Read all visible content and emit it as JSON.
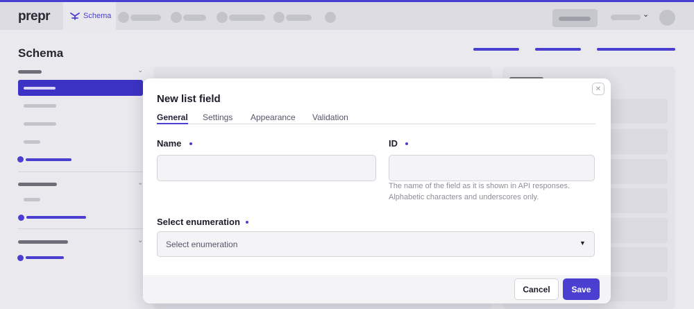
{
  "app": {
    "logo": "prepr",
    "nav_active_label": "Schema",
    "page_title": "Schema"
  },
  "modal": {
    "title": "New list field",
    "tabs": [
      {
        "label": "General",
        "active": true
      },
      {
        "label": "Settings",
        "active": false
      },
      {
        "label": "Appearance",
        "active": false
      },
      {
        "label": "Validation",
        "active": false
      }
    ],
    "name_label": "Name",
    "name_value": "",
    "id_label": "ID",
    "id_value": "",
    "id_help": "The name of the field as it is shown in API responses. Alphabetic characters and underscores only.",
    "enumeration_label": "Select enumeration",
    "enumeration_placeholder": "Select enumeration",
    "cancel_label": "Cancel",
    "save_label": "Save",
    "close_icon": "close-icon"
  },
  "colors": {
    "accent": "#4a3fd0",
    "overlay": "#c9c9ce",
    "modal_bg": "#ffffff",
    "field_bg": "#f4f4f7"
  }
}
